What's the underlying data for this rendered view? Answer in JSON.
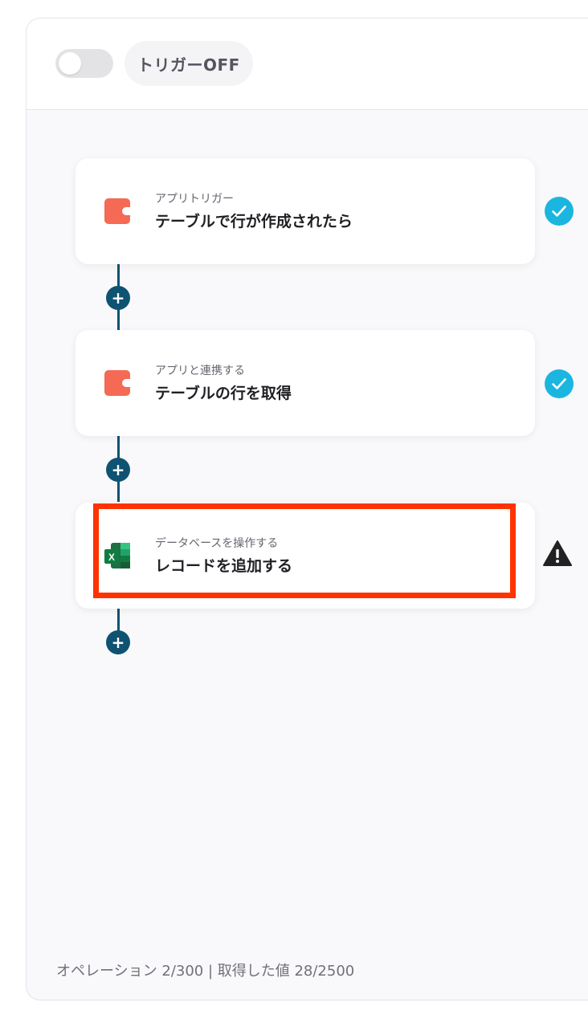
{
  "header": {
    "trigger_label": "トリガーOFF",
    "trigger_on": false
  },
  "steps": [
    {
      "subtitle": "アプリトリガー",
      "title": "テーブルで行が作成されたら",
      "app_icon": "coda-icon",
      "status": "complete"
    },
    {
      "subtitle": "アプリと連携する",
      "title": "テーブルの行を取得",
      "app_icon": "coda-icon",
      "status": "complete"
    },
    {
      "subtitle": "データベースを操作する",
      "title": "レコードを追加する",
      "app_icon": "excel-icon",
      "status": "warning"
    }
  ],
  "footer": {
    "stats": "オペレーション 2/300 | 取得した値 28/2500"
  },
  "colors": {
    "connector": "#0f5372",
    "check": "#1bb6df",
    "warning": "#222222",
    "highlight": "#ff3300",
    "coda": "#f46a54",
    "excel": "#1d7044"
  }
}
